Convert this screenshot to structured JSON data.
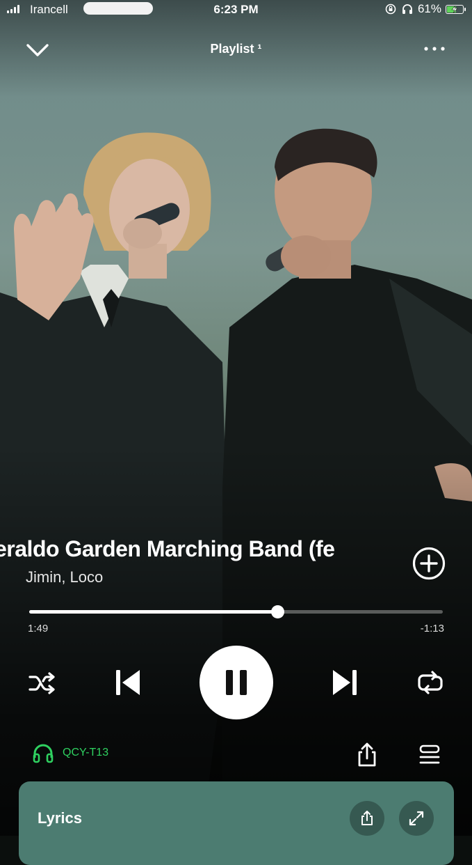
{
  "status_bar": {
    "carrier": "Irancell",
    "time": "6:23 PM",
    "battery_percent": "61%",
    "battery_level": 0.61,
    "icons": [
      "signal-bars-icon",
      "orientation-lock-icon",
      "headphones-icon",
      "battery-charging-icon"
    ]
  },
  "header": {
    "title": "Playlist ¹",
    "collapse_icon": "chevron-down-icon",
    "more_icon": "more-dots-icon"
  },
  "track": {
    "title": "eraldo Garden Marching Band (fe",
    "artist": "Jimin, Loco"
  },
  "progress": {
    "elapsed": "1:49",
    "remaining": "-1:13",
    "fraction": 0.6
  },
  "controls": {
    "shuffle_icon": "shuffle-icon",
    "previous_icon": "skip-previous-icon",
    "play_pause_icon": "pause-icon",
    "next_icon": "skip-next-icon",
    "repeat_icon": "repeat-icon"
  },
  "device": {
    "name": "QCY-T13",
    "icon": "headphones-icon",
    "color": "#2fd160"
  },
  "actions": {
    "share_icon": "share-icon",
    "queue_icon": "queue-icon"
  },
  "lyrics": {
    "title": "Lyrics",
    "card_color": "#4c7c71",
    "share_icon": "share-icon",
    "expand_icon": "expand-icon"
  }
}
